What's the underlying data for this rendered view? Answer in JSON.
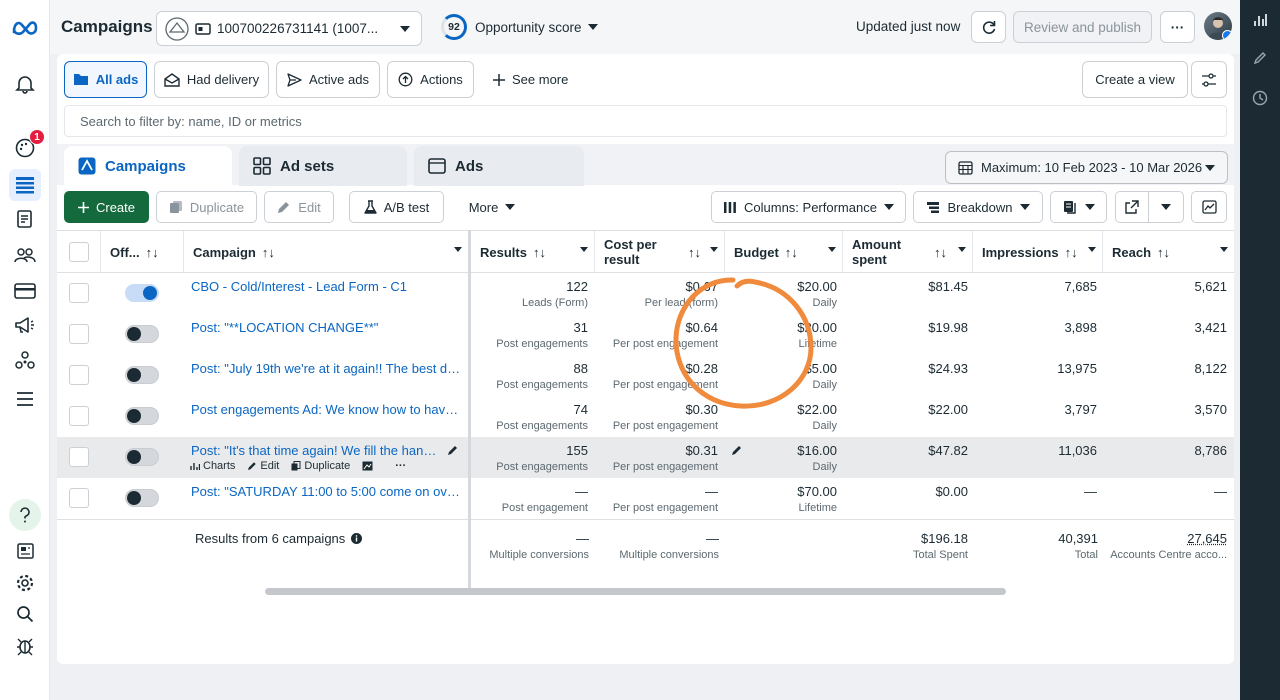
{
  "header": {
    "title": "Campaigns",
    "account_id": "100700226731141 (1007...",
    "opportunity_score": "92",
    "opportunity_label": "Opportunity score",
    "updated": "Updated just now",
    "review_publish": "Review and publish",
    "more": "···"
  },
  "leftbar": {
    "notification_badge": "1"
  },
  "filters": {
    "all_ads": "All ads",
    "had_delivery": "Had delivery",
    "active_ads": "Active ads",
    "actions": "Actions",
    "see_more": "See more",
    "create_view": "Create a view",
    "search_placeholder": "Search to filter by: name, ID or metrics"
  },
  "tabs": {
    "campaigns": "Campaigns",
    "ad_sets": "Ad sets",
    "ads": "Ads",
    "date_range": "Maximum: 10 Feb 2023 - 10 Mar 2026"
  },
  "toolbar": {
    "create": "Create",
    "duplicate": "Duplicate",
    "edit": "Edit",
    "ab_test": "A/B test",
    "more": "More",
    "columns": "Columns: Performance",
    "breakdown": "Breakdown"
  },
  "columns": {
    "off": "Off...",
    "campaign": "Campaign",
    "results": "Results",
    "cost_per_result": "Cost per result",
    "budget": "Budget",
    "amount_spent": "Amount spent",
    "impressions": "Impressions",
    "reach": "Reach",
    "sort": "↑↓"
  },
  "rows": [
    {
      "name": "CBO - Cold/Interest - Lead Form - C1",
      "results": "122",
      "results_sub": "Leads (Form)",
      "cost": "$0.67",
      "cost_sub": "Per lead (form)",
      "budget": "$20.00",
      "budget_sub": "Daily",
      "spent": "$81.45",
      "impressions": "7,685",
      "reach": "5,621",
      "on": true
    },
    {
      "name": "Post: \"**LOCATION CHANGE**\"",
      "results": "31",
      "results_sub": "Post engagements",
      "cost": "$0.64",
      "cost_sub": "Per post engagement",
      "budget": "$20.00",
      "budget_sub": "Lifetime",
      "spent": "$19.98",
      "impressions": "3,898",
      "reach": "3,421",
      "on": false
    },
    {
      "name": "Post: \"July 19th we're at it again!! The best de...",
      "results": "88",
      "results_sub": "Post engagements",
      "cost": "$0.28",
      "cost_sub": "Per post engagement",
      "budget": "$5.00",
      "budget_sub": "Daily",
      "spent": "$24.93",
      "impressions": "13,975",
      "reach": "8,122",
      "on": false
    },
    {
      "name": "Post engagements Ad: We know how to have ...",
      "results": "74",
      "results_sub": "Post engagements",
      "cost": "$0.30",
      "cost_sub": "Per post engagement",
      "budget": "$22.00",
      "budget_sub": "Daily",
      "spent": "$22.00",
      "impressions": "3,797",
      "reach": "3,570",
      "on": false
    },
    {
      "name": "Post: \"It's that time again! We fill the hang...",
      "results": "155",
      "results_sub": "Post engagements",
      "cost": "$0.31",
      "cost_sub": "Per post engagement",
      "budget": "$16.00",
      "budget_sub": "Daily",
      "spent": "$47.82",
      "impressions": "11,036",
      "reach": "8,786",
      "on": false
    },
    {
      "name": "Post: \"SATURDAY 11:00 to 5:00 come on ove...",
      "results": "—",
      "results_sub": "Post engagement",
      "cost": "—",
      "cost_sub": "Per post engagement",
      "budget": "$70.00",
      "budget_sub": "Lifetime",
      "spent": "$0.00",
      "impressions": "—",
      "reach": "—",
      "on": false
    }
  ],
  "row_actions": {
    "charts": "Charts",
    "edit": "Edit",
    "duplicate": "Duplicate",
    "more": "···"
  },
  "totals": {
    "label": "Results from 6 campaigns",
    "results": "—",
    "results_sub": "Multiple conversions",
    "cost": "—",
    "cost_sub": "Multiple conversions",
    "spent": "$196.18",
    "spent_sub": "Total Spent",
    "impressions": "40,391",
    "impressions_sub": "Total",
    "reach": "27,645",
    "reach_sub": "Accounts Centre acco..."
  },
  "colors": {
    "accent": "#0a66c2",
    "create_button": "#146a3d",
    "annotation": "#f08a3c",
    "badge": "#e41e3f"
  }
}
